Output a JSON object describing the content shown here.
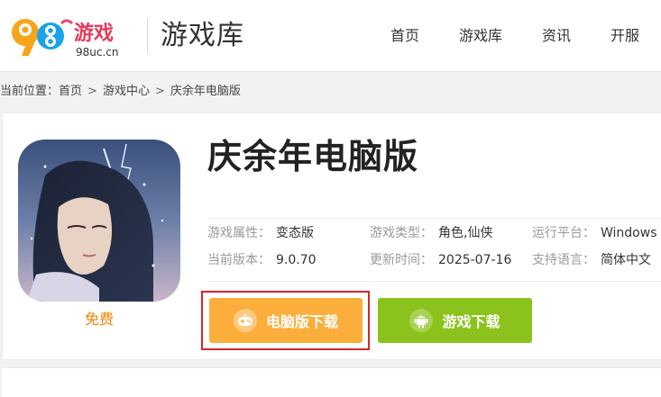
{
  "header": {
    "logo": {
      "digits": "98",
      "brand": "游戏",
      "domain": "98uc.cn"
    },
    "section_title": "游戏库",
    "nav": [
      "首页",
      "游戏库",
      "资讯",
      "开服"
    ]
  },
  "breadcrumb": {
    "prefix": "当前位置：",
    "items": [
      "首页",
      "游戏中心",
      "庆余年电脑版"
    ],
    "separator": ">"
  },
  "game": {
    "title": "庆余年电脑版",
    "price": "免费",
    "info": [
      {
        "key": "游戏属性：",
        "value": "变态版"
      },
      {
        "key": "游戏类型：",
        "value": "角色,仙侠"
      },
      {
        "key": "运行平台：",
        "value": "Windows"
      },
      {
        "key": "当前版本：",
        "value": "9.0.70"
      },
      {
        "key": "更新时间：",
        "value": "2025-07-16"
      },
      {
        "key": "支持语言：",
        "value": "简体中文"
      }
    ]
  },
  "buttons": {
    "pc_download": "电脑版下载",
    "mobile_download": "游戏下载"
  },
  "colors": {
    "accent_orange": "#fbae3c",
    "accent_green": "#8bc31c",
    "price_orange": "#f08300",
    "highlight_red": "#d6262b"
  },
  "icons": {
    "pc": "game-controller-icon",
    "mobile": "android-icon"
  }
}
